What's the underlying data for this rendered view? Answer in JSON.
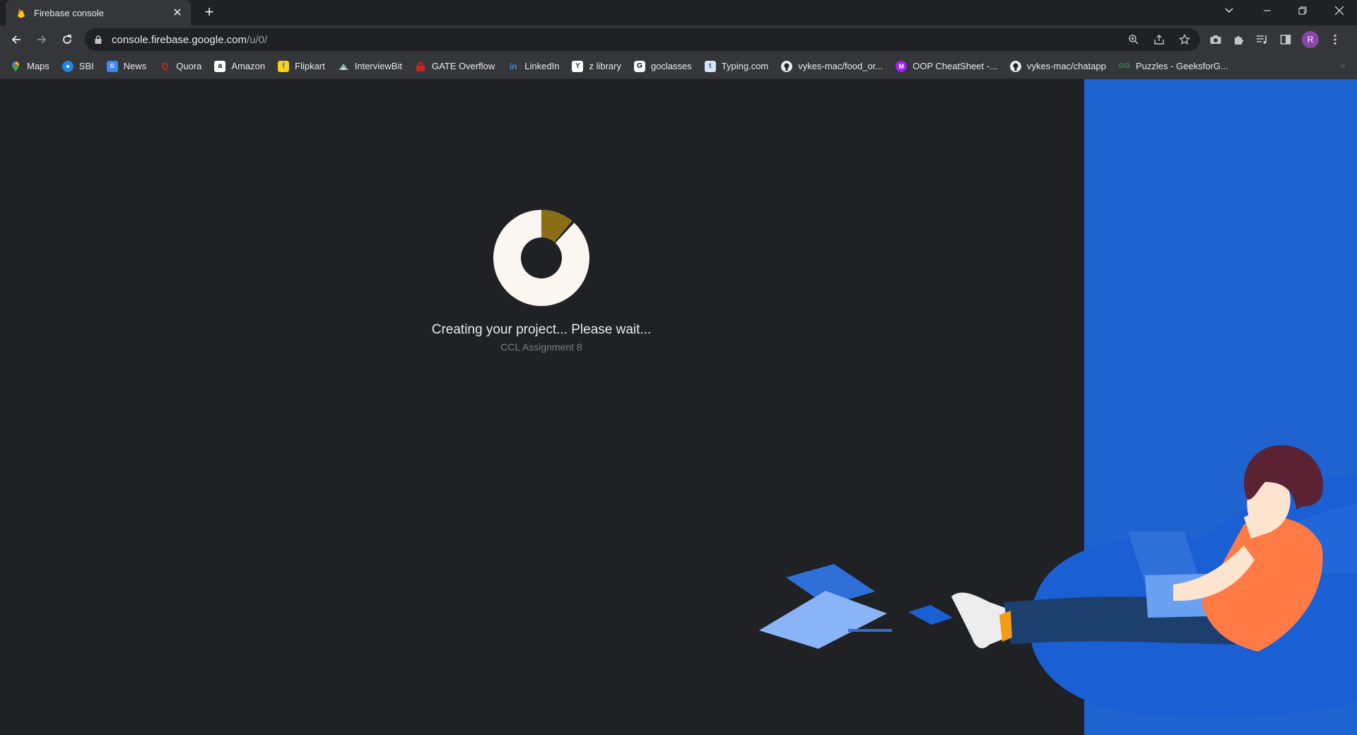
{
  "browser": {
    "tab": {
      "title": "Firebase console",
      "favicon": "firebase-icon"
    },
    "window_controls": [
      "tab-search-icon",
      "minimize-icon",
      "restore-icon",
      "close-icon"
    ],
    "address": {
      "host": "console.firebase.google.com",
      "path": "/u/0/"
    },
    "omnibox_icons": [
      "zoom-icon",
      "share-icon",
      "star-icon"
    ],
    "toolbar_icons": [
      "camera-icon",
      "extensions-icon",
      "reading-list-icon",
      "side-panel-icon",
      "profile-avatar",
      "menu-icon"
    ],
    "profile_initial": "R"
  },
  "bookmarks": [
    {
      "label": "Maps",
      "icon": "maps-icon",
      "color": "#34a853"
    },
    {
      "label": "SBI",
      "icon": "sbi-icon",
      "color": "#1e88e5"
    },
    {
      "label": "News",
      "icon": "news-icon",
      "color": "#4285f4"
    },
    {
      "label": "Quora",
      "icon": "quora-icon",
      "color": "#b92b27"
    },
    {
      "label": "Amazon",
      "icon": "amazon-icon",
      "color": "#ffffff"
    },
    {
      "label": "Flipkart",
      "icon": "flipkart-icon",
      "color": "#f7d117"
    },
    {
      "label": "InterviewBit",
      "icon": "interviewbit-icon",
      "color": "#7fb8a4"
    },
    {
      "label": "GATE Overflow",
      "icon": "gate-overflow-icon",
      "color": "#c62828"
    },
    {
      "label": "LinkedIn",
      "icon": "linkedin-icon",
      "color": "#0a66c2"
    },
    {
      "label": "z library",
      "icon": "zlibrary-icon",
      "color": "#ffffff"
    },
    {
      "label": "goclasses",
      "icon": "goclasses-icon",
      "color": "#ffffff"
    },
    {
      "label": "Typing.com",
      "icon": "typing-icon",
      "color": "#5b8fd6"
    },
    {
      "label": "vykes-mac/food_or...",
      "icon": "github-icon",
      "color": "#e8eaed"
    },
    {
      "label": "OOP CheatSheet -...",
      "icon": "m-icon",
      "color": "#a020f0"
    },
    {
      "label": "vykes-mac/chatapp",
      "icon": "github-icon",
      "color": "#e8eaed"
    },
    {
      "label": "Puzzles - GeeksforG...",
      "icon": "geeksforgeeks-icon",
      "color": "#2f8d46"
    }
  ],
  "main": {
    "status_message": "Creating your project... Please wait...",
    "project_name": "CCL Assignment 8",
    "progress": 0.11
  },
  "colors": {
    "page_bg": "#202124",
    "panel_blue": "#1e63d0",
    "loader_fill": "#fbf6ef",
    "loader_progress": "#8a6d14"
  }
}
